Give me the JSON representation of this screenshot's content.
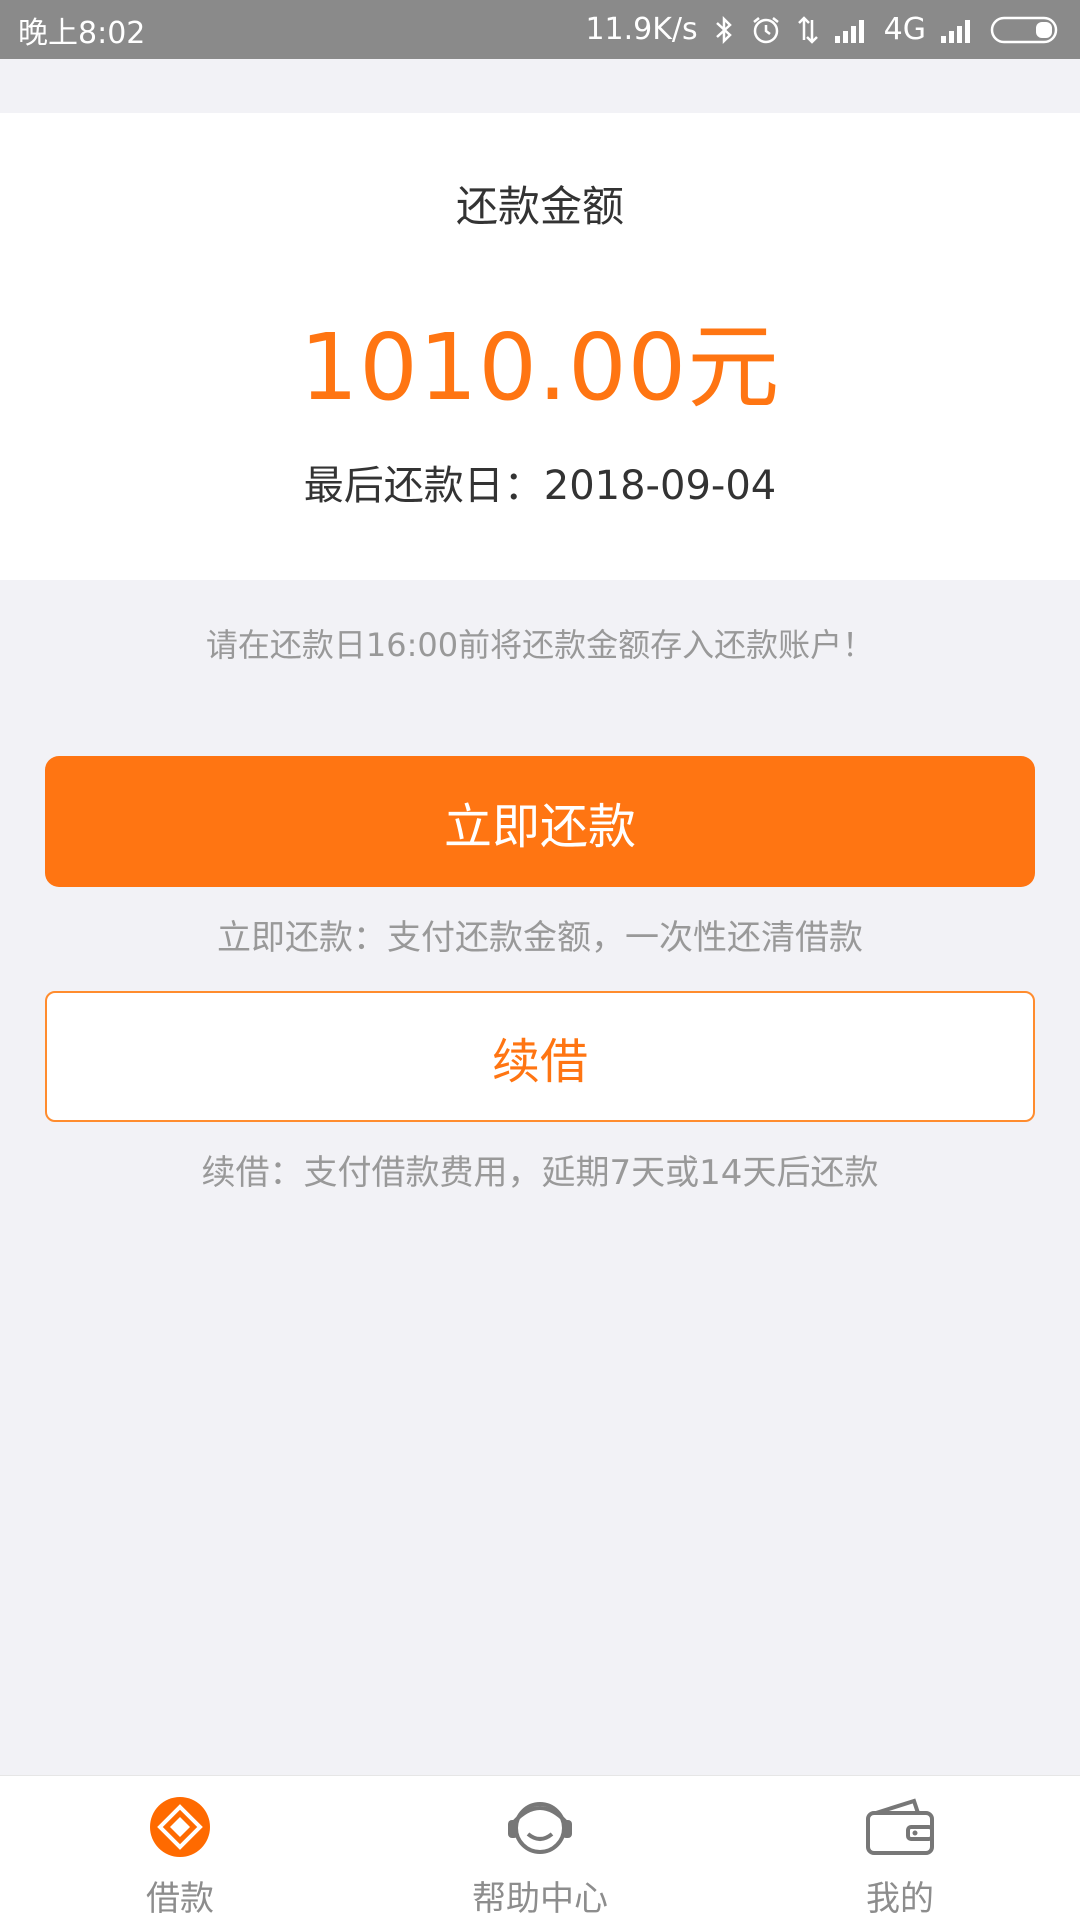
{
  "status_bar": {
    "time": "晚上8:02",
    "speed": "11.9K/s",
    "network": "4G",
    "icons": [
      "bluetooth-icon",
      "alarm-icon",
      "data-arrows-icon",
      "signal-icon",
      "signal-icon-2",
      "battery-icon"
    ]
  },
  "amount_card": {
    "title": "还款金额",
    "amount": "1010.00元",
    "due_date": "最后还款日：2018-09-04"
  },
  "notice": "请在还款日16:00前将还款金额存入还款账户！",
  "actions": {
    "repay_label": "立即还款",
    "repay_hint": "立即还款：支付还款金额，一次性还清借款",
    "renew_label": "续借",
    "renew_hint": "续借：支付借款费用，延期7天或14天后还款"
  },
  "bottom_nav": {
    "items": [
      {
        "label": "借款",
        "icon": "loan-icon",
        "active": true
      },
      {
        "label": "帮助中心",
        "icon": "headset-icon",
        "active": false
      },
      {
        "label": "我的",
        "icon": "wallet-icon",
        "active": false
      }
    ]
  },
  "colors": {
    "accent": "#ff7512",
    "status_bar": "#8a8a8a",
    "background": "#f2f2f6"
  }
}
